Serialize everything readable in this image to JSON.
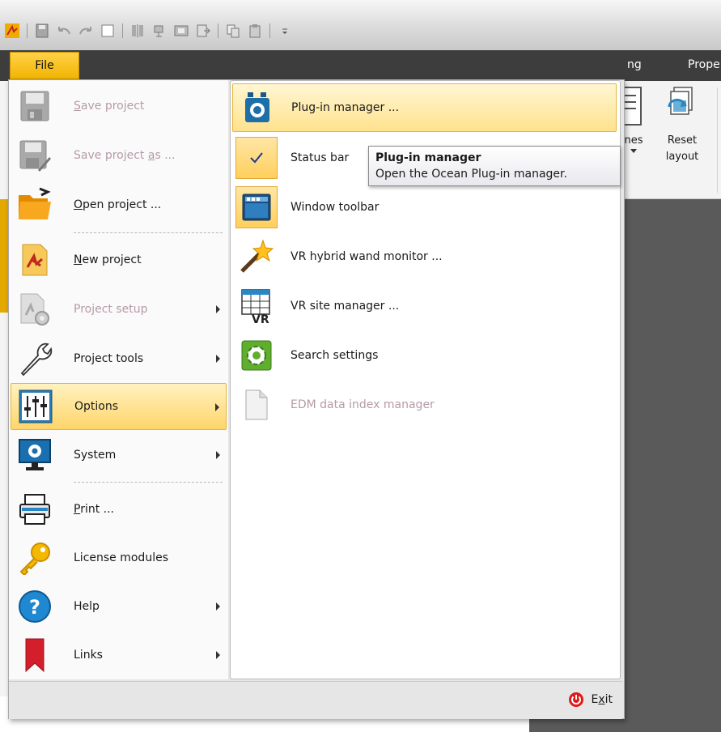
{
  "quick_access": {
    "icons": [
      "app-logo-icon",
      "save-icon",
      "undo-icon",
      "redo-icon",
      "blank-doc-icon",
      "align-icon",
      "model-icon",
      "film-icon",
      "export-icon",
      "copy-icon",
      "paste-icon",
      "customize-icon"
    ]
  },
  "ribbon": {
    "tabs": [
      {
        "label": "ng"
      },
      {
        "label": "Prope"
      }
    ],
    "buttons": [
      {
        "label_line1": "nes",
        "label_line2": ""
      },
      {
        "label_line1": "Reset",
        "label_line2": "layout"
      }
    ]
  },
  "file_tab": {
    "label": "File"
  },
  "left_menu": {
    "items": [
      {
        "label": "Save project",
        "accel": "S",
        "rest": "ave project",
        "icon": "floppy-disk-icon",
        "disabled": true,
        "submenu": false
      },
      {
        "label": "Save project as ...",
        "pre": "Save project ",
        "accel": "a",
        "rest": "s ...",
        "icon": "floppy-pencil-icon",
        "disabled": true,
        "submenu": false
      },
      {
        "label": "Open project ...",
        "accel": "O",
        "rest": "pen project ...",
        "icon": "folder-open-icon",
        "disabled": false,
        "submenu": false
      },
      {
        "label": "New project",
        "accel": "N",
        "rest": "ew project",
        "icon": "new-project-icon",
        "disabled": false,
        "submenu": false
      },
      {
        "label": "Project setup",
        "icon": "project-setup-icon",
        "disabled": true,
        "submenu": true
      },
      {
        "label": "Project tools",
        "icon": "wrench-icon",
        "disabled": false,
        "submenu": true
      },
      {
        "label": "Options",
        "icon": "sliders-icon",
        "disabled": false,
        "submenu": true,
        "active": true
      },
      {
        "label": "System",
        "icon": "monitor-gear-icon",
        "disabled": false,
        "submenu": true
      },
      {
        "label": "Print ...",
        "accel": "P",
        "rest": "rint ...",
        "icon": "printer-icon",
        "disabled": false,
        "submenu": false
      },
      {
        "label": "License modules",
        "icon": "key-icon",
        "disabled": false,
        "submenu": false
      },
      {
        "label": "Help",
        "icon": "help-icon",
        "disabled": false,
        "submenu": true
      },
      {
        "label": "Links",
        "icon": "bookmark-icon",
        "disabled": false,
        "submenu": true
      }
    ]
  },
  "options_submenu": {
    "items": [
      {
        "label": "Plug-in manager ...",
        "icon": "plugin-manager-icon",
        "hover": true
      },
      {
        "label": "Status bar",
        "icon": "check-icon",
        "checked": true
      },
      {
        "label": "Window toolbar",
        "icon": "window-toolbar-icon",
        "checked": true
      },
      {
        "label": "VR hybrid wand monitor ...",
        "icon": "magic-wand-icon"
      },
      {
        "label": "VR site manager ...",
        "icon": "vr-grid-icon"
      },
      {
        "label": "Search settings",
        "icon": "search-settings-gear-icon"
      },
      {
        "label": "EDM data index manager",
        "icon": "blank-page-icon",
        "disabled": true
      }
    ]
  },
  "tooltip": {
    "title": "Plug-in manager",
    "description": "Open the Ocean Plug-in manager."
  },
  "footer": {
    "exit_accel_pre": "E",
    "exit_accel": "x",
    "exit_rest": "it",
    "exit_label": "Exit"
  },
  "colors": {
    "accent": "#f2b400",
    "ribbon_dark": "#3d3d3d",
    "hover_fill": "#ffd56a",
    "disabled_text": "#b69aa8",
    "exit_red": "#e01a1a"
  }
}
